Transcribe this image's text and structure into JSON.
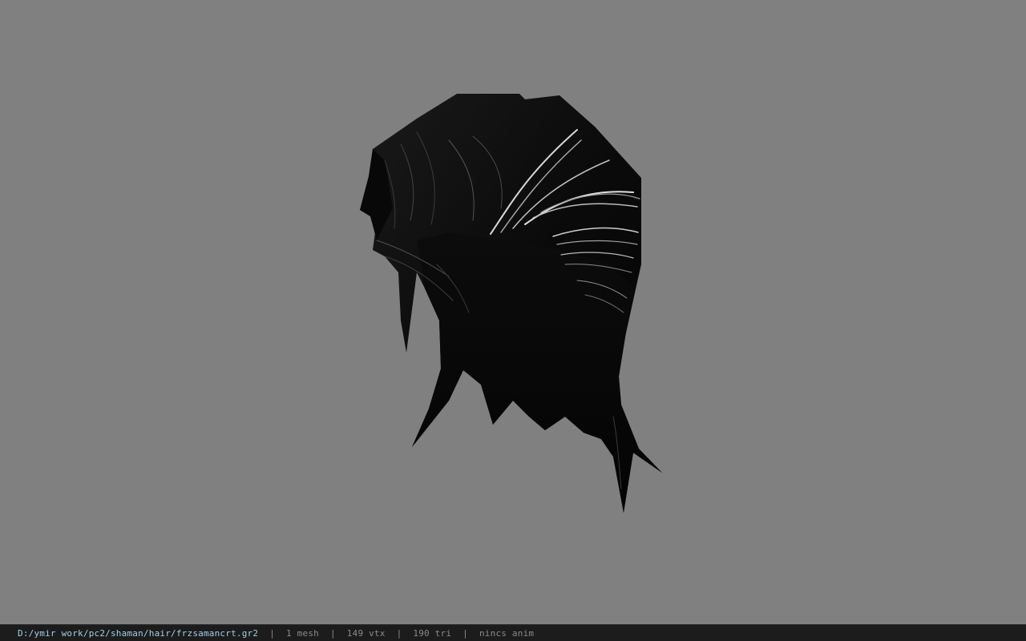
{
  "viewer": {
    "background_color": "#808080",
    "model_icon": "hair-mesh-icon"
  },
  "statusbar": {
    "file_path": "D:/ymir work/pc2/shaman/hair/frzsamancrt.gr2",
    "mesh_count": "1 mesh",
    "vertex_count": "149 vtx",
    "triangle_count": "190 tri",
    "anim_status": "nincs anim",
    "path_color": "#9fd0e8",
    "text_color": "#8a8a8a"
  }
}
